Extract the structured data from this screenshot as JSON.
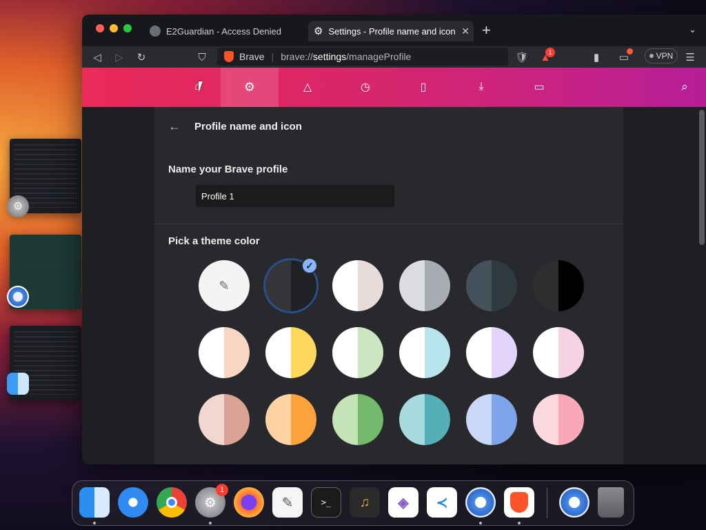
{
  "browser": {
    "tabs": [
      {
        "label": "E2Guardian - Access Denied",
        "active": false
      },
      {
        "label": "Settings - Profile name and icon",
        "active": true
      }
    ],
    "url": {
      "brand": "Brave",
      "scheme": "brave://",
      "host": "settings",
      "path": "/manageProfile"
    },
    "vpn_label": "VPN",
    "rewards_badge": "1"
  },
  "page": {
    "title": "Profile name and icon",
    "name_heading": "Name your Brave profile",
    "profile_name": "Profile 1",
    "theme_heading": "Pick a theme color",
    "swatches": [
      {
        "left": "#f4f4f5",
        "right": "#f4f4f5",
        "picker": true
      },
      {
        "left": "#35363a",
        "right": "#202124",
        "selected": true
      },
      {
        "left": "#ffffff",
        "right": "#e8dcda"
      },
      {
        "left": "#dadce0",
        "right": "#a9abb3"
      },
      {
        "left": "#45525b",
        "right": "#2f3a41"
      },
      {
        "left": "#2e2e2e",
        "right": "#000000"
      },
      {
        "left": "#ffffff",
        "right": "#f9d6c4"
      },
      {
        "left": "#ffffff",
        "right": "#fdd85d"
      },
      {
        "left": "#ffffff",
        "right": "#cce6c2"
      },
      {
        "left": "#ffffff",
        "right": "#b8e4ee"
      },
      {
        "left": "#ffffff",
        "right": "#e3d4fb"
      },
      {
        "left": "#ffffff",
        "right": "#f6d3e2"
      },
      {
        "left": "#f1d7cf",
        "right": "#dba296"
      },
      {
        "left": "#ffd2a4",
        "right": "#fba23d"
      },
      {
        "left": "#c4e3b7",
        "right": "#73b86b"
      },
      {
        "left": "#a8dbde",
        "right": "#54b0b6"
      },
      {
        "left": "#cad8f7",
        "right": "#7fa4e9"
      },
      {
        "left": "#fcd8df",
        "right": "#f9a8b7"
      }
    ]
  },
  "dock": {
    "settings_badge": "1",
    "apps": [
      "finder-icon",
      "safari-icon",
      "chrome-icon",
      "system-settings-icon",
      "firefox-icon",
      "textedit-icon",
      "terminal-icon",
      "garageband-icon",
      "visual-studio-icon",
      "vscode-icon",
      "chromium-icon",
      "brave-icon",
      "chromium-recent-icon",
      "trash-icon"
    ]
  }
}
